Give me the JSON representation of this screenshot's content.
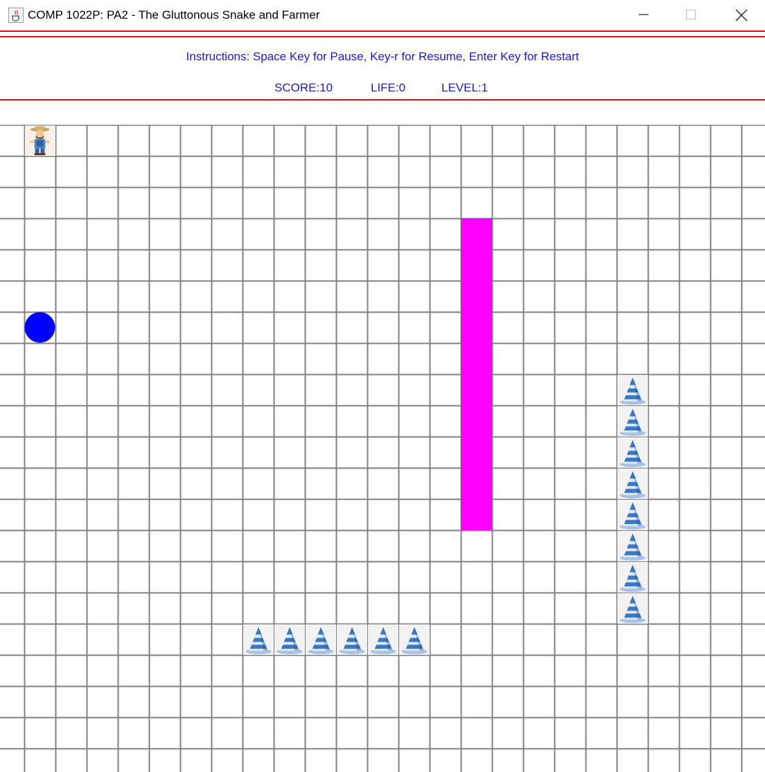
{
  "window": {
    "title": "COMP 1022P: PA2 - The Gluttonous Snake and Farmer",
    "icon": "java-cup-icon",
    "controls": [
      "minimize-icon",
      "maximize-icon",
      "close-icon"
    ]
  },
  "header": {
    "instructions": "Instructions: Space Key for Pause, Key-r for Resume, Enter Key for Restart",
    "score": "SCORE:10",
    "life": "LIFE:0",
    "level": "LEVEL:1"
  },
  "colors": {
    "accent_text": "#1a1ad6",
    "divider": "#e01010",
    "grid": "#808080",
    "snake": "#ff00ff",
    "food": "#0000ff"
  },
  "board": {
    "columns": 25,
    "rows": 21,
    "farmer": {
      "icon": "farmer-icon",
      "col": 0,
      "row": 0
    },
    "food": {
      "icon": "blue-dot",
      "col": 0,
      "row": 6
    },
    "snake": {
      "col": 14,
      "row_start": 3,
      "row_end": 12
    },
    "cones": [
      {
        "col": 19,
        "row": 8
      },
      {
        "col": 19,
        "row": 9
      },
      {
        "col": 19,
        "row": 10
      },
      {
        "col": 19,
        "row": 11
      },
      {
        "col": 19,
        "row": 12
      },
      {
        "col": 19,
        "row": 13
      },
      {
        "col": 19,
        "row": 14
      },
      {
        "col": 19,
        "row": 15
      },
      {
        "col": 7,
        "row": 16
      },
      {
        "col": 8,
        "row": 16
      },
      {
        "col": 9,
        "row": 16
      },
      {
        "col": 10,
        "row": 16
      },
      {
        "col": 11,
        "row": 16
      },
      {
        "col": 12,
        "row": 16
      }
    ]
  }
}
